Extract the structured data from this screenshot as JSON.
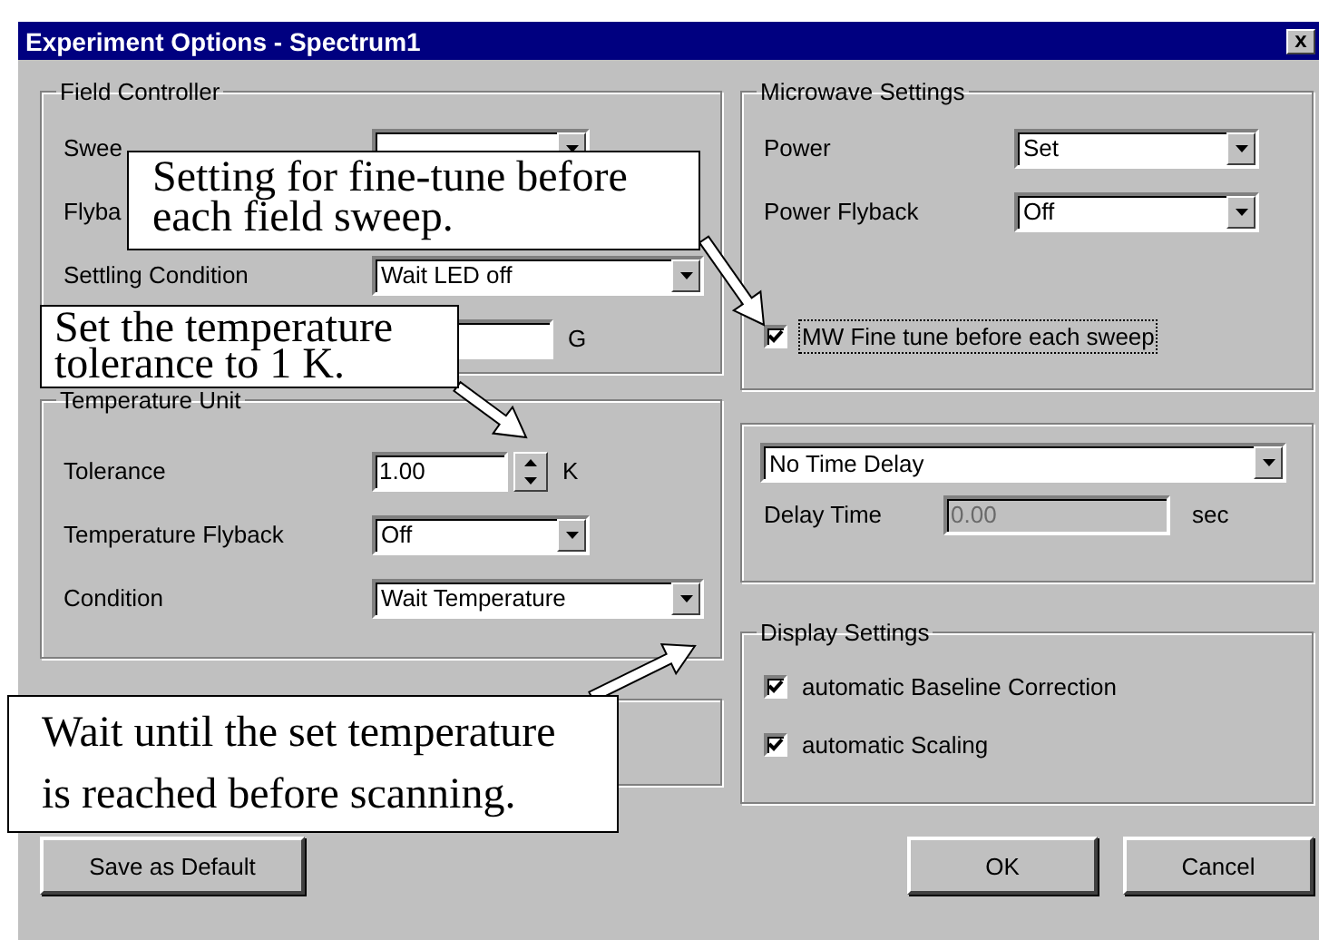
{
  "window": {
    "title": "Experiment Options - Spectrum1",
    "close": "x"
  },
  "field_controller": {
    "title": "Field Controller",
    "rows": [
      {
        "kind": "short_dropdown",
        "label": "Swee"
      },
      {
        "kind": "covered",
        "label": "Flyba"
      },
      {
        "kind": "wide_dropdown",
        "label": "Settling Condition",
        "value": "Wait LED off"
      },
      {
        "kind": "field",
        "unit": "G"
      }
    ]
  },
  "temperature_unit": {
    "title": "Temperature Unit",
    "rows": [
      {
        "kind": "spin",
        "label": "Tolerance",
        "value": "1.00",
        "unit": "K"
      },
      {
        "kind": "short_dropdown",
        "label": "Temperature Flyback",
        "value": "Off"
      },
      {
        "kind": "wide_dropdown",
        "label": "Condition",
        "value": "Wait Temperature"
      }
    ]
  },
  "microwave": {
    "title": "Microwave Settings",
    "rows": [
      {
        "kind": "short_dropdown",
        "label": "Power",
        "value": "Set"
      },
      {
        "kind": "short_dropdown",
        "label": "Power Flyback",
        "value": "Off"
      }
    ],
    "checkbox": {
      "label": "MW Fine tune before each sweep",
      "checked": true,
      "focused": true
    }
  },
  "delay": {
    "mode": "No Time Delay",
    "delay_time": {
      "label": "Delay Time",
      "value": "0.00",
      "unit": "sec",
      "disabled": true
    }
  },
  "display_settings": {
    "title": "Display Settings",
    "checkboxes": [
      {
        "label": "automatic Baseline Correction",
        "checked": true
      },
      {
        "label": "automatic Scaling",
        "checked": true
      }
    ]
  },
  "buttons": [
    {
      "label": "Save as Default",
      "kind": "left"
    },
    {
      "label": "OK",
      "kind": "right"
    },
    {
      "label": "Cancel",
      "kind": "right"
    }
  ],
  "callouts": [
    {
      "text": "Setting for fine-tune before each field sweep.",
      "kind": "finetune"
    },
    {
      "text": "Set the temperature tolerance to 1 K.",
      "kind": "tolerance"
    },
    {
      "text": "Wait until the set temperature is reached before scanning.",
      "kind": "condition"
    }
  ]
}
